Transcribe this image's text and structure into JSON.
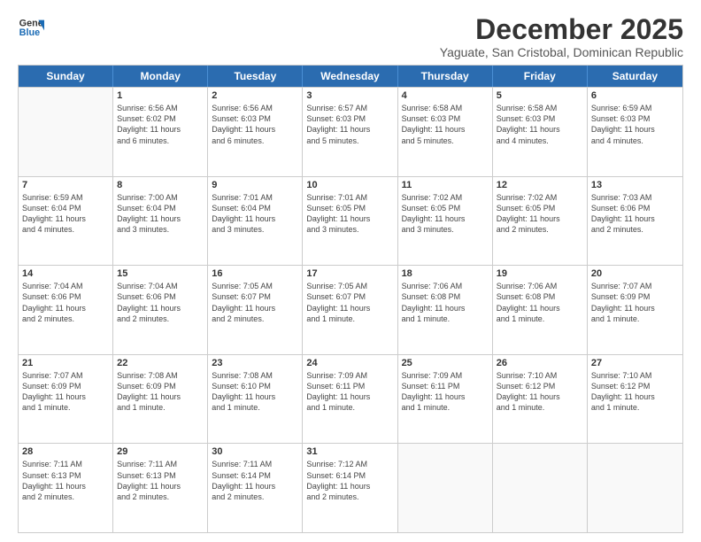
{
  "logo": {
    "line1": "General",
    "line2": "Blue"
  },
  "header": {
    "month": "December 2025",
    "location": "Yaguate, San Cristobal, Dominican Republic"
  },
  "weekdays": [
    "Sunday",
    "Monday",
    "Tuesday",
    "Wednesday",
    "Thursday",
    "Friday",
    "Saturday"
  ],
  "weeks": [
    [
      {
        "day": "",
        "info": ""
      },
      {
        "day": "1",
        "info": "Sunrise: 6:56 AM\nSunset: 6:02 PM\nDaylight: 11 hours\nand 6 minutes."
      },
      {
        "day": "2",
        "info": "Sunrise: 6:56 AM\nSunset: 6:03 PM\nDaylight: 11 hours\nand 6 minutes."
      },
      {
        "day": "3",
        "info": "Sunrise: 6:57 AM\nSunset: 6:03 PM\nDaylight: 11 hours\nand 5 minutes."
      },
      {
        "day": "4",
        "info": "Sunrise: 6:58 AM\nSunset: 6:03 PM\nDaylight: 11 hours\nand 5 minutes."
      },
      {
        "day": "5",
        "info": "Sunrise: 6:58 AM\nSunset: 6:03 PM\nDaylight: 11 hours\nand 4 minutes."
      },
      {
        "day": "6",
        "info": "Sunrise: 6:59 AM\nSunset: 6:03 PM\nDaylight: 11 hours\nand 4 minutes."
      }
    ],
    [
      {
        "day": "7",
        "info": "Sunrise: 6:59 AM\nSunset: 6:04 PM\nDaylight: 11 hours\nand 4 minutes."
      },
      {
        "day": "8",
        "info": "Sunrise: 7:00 AM\nSunset: 6:04 PM\nDaylight: 11 hours\nand 3 minutes."
      },
      {
        "day": "9",
        "info": "Sunrise: 7:01 AM\nSunset: 6:04 PM\nDaylight: 11 hours\nand 3 minutes."
      },
      {
        "day": "10",
        "info": "Sunrise: 7:01 AM\nSunset: 6:05 PM\nDaylight: 11 hours\nand 3 minutes."
      },
      {
        "day": "11",
        "info": "Sunrise: 7:02 AM\nSunset: 6:05 PM\nDaylight: 11 hours\nand 3 minutes."
      },
      {
        "day": "12",
        "info": "Sunrise: 7:02 AM\nSunset: 6:05 PM\nDaylight: 11 hours\nand 2 minutes."
      },
      {
        "day": "13",
        "info": "Sunrise: 7:03 AM\nSunset: 6:06 PM\nDaylight: 11 hours\nand 2 minutes."
      }
    ],
    [
      {
        "day": "14",
        "info": "Sunrise: 7:04 AM\nSunset: 6:06 PM\nDaylight: 11 hours\nand 2 minutes."
      },
      {
        "day": "15",
        "info": "Sunrise: 7:04 AM\nSunset: 6:06 PM\nDaylight: 11 hours\nand 2 minutes."
      },
      {
        "day": "16",
        "info": "Sunrise: 7:05 AM\nSunset: 6:07 PM\nDaylight: 11 hours\nand 2 minutes."
      },
      {
        "day": "17",
        "info": "Sunrise: 7:05 AM\nSunset: 6:07 PM\nDaylight: 11 hours\nand 1 minute."
      },
      {
        "day": "18",
        "info": "Sunrise: 7:06 AM\nSunset: 6:08 PM\nDaylight: 11 hours\nand 1 minute."
      },
      {
        "day": "19",
        "info": "Sunrise: 7:06 AM\nSunset: 6:08 PM\nDaylight: 11 hours\nand 1 minute."
      },
      {
        "day": "20",
        "info": "Sunrise: 7:07 AM\nSunset: 6:09 PM\nDaylight: 11 hours\nand 1 minute."
      }
    ],
    [
      {
        "day": "21",
        "info": "Sunrise: 7:07 AM\nSunset: 6:09 PM\nDaylight: 11 hours\nand 1 minute."
      },
      {
        "day": "22",
        "info": "Sunrise: 7:08 AM\nSunset: 6:09 PM\nDaylight: 11 hours\nand 1 minute."
      },
      {
        "day": "23",
        "info": "Sunrise: 7:08 AM\nSunset: 6:10 PM\nDaylight: 11 hours\nand 1 minute."
      },
      {
        "day": "24",
        "info": "Sunrise: 7:09 AM\nSunset: 6:11 PM\nDaylight: 11 hours\nand 1 minute."
      },
      {
        "day": "25",
        "info": "Sunrise: 7:09 AM\nSunset: 6:11 PM\nDaylight: 11 hours\nand 1 minute."
      },
      {
        "day": "26",
        "info": "Sunrise: 7:10 AM\nSunset: 6:12 PM\nDaylight: 11 hours\nand 1 minute."
      },
      {
        "day": "27",
        "info": "Sunrise: 7:10 AM\nSunset: 6:12 PM\nDaylight: 11 hours\nand 1 minute."
      }
    ],
    [
      {
        "day": "28",
        "info": "Sunrise: 7:11 AM\nSunset: 6:13 PM\nDaylight: 11 hours\nand 2 minutes."
      },
      {
        "day": "29",
        "info": "Sunrise: 7:11 AM\nSunset: 6:13 PM\nDaylight: 11 hours\nand 2 minutes."
      },
      {
        "day": "30",
        "info": "Sunrise: 7:11 AM\nSunset: 6:14 PM\nDaylight: 11 hours\nand 2 minutes."
      },
      {
        "day": "31",
        "info": "Sunrise: 7:12 AM\nSunset: 6:14 PM\nDaylight: 11 hours\nand 2 minutes."
      },
      {
        "day": "",
        "info": ""
      },
      {
        "day": "",
        "info": ""
      },
      {
        "day": "",
        "info": ""
      }
    ]
  ]
}
